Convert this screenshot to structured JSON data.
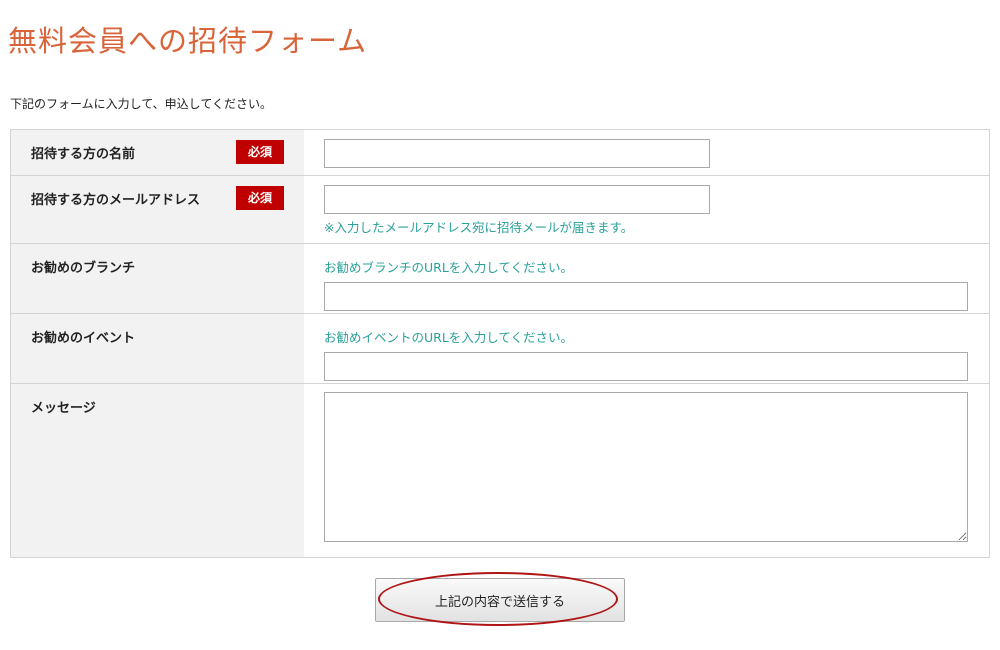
{
  "page": {
    "title": "無料会員への招待フォーム",
    "intro": "下記のフォームに入力して、申込してください。"
  },
  "form": {
    "required_badge": "必須",
    "fields": [
      {
        "label": "招待する方の名前",
        "required": true
      },
      {
        "label": "招待する方のメールアドレス",
        "required": true,
        "hint": "※入力したメールアドレス宛に招待メールが届きます。"
      },
      {
        "label": "お勧めのブランチ",
        "required": false,
        "hint": "お勧めブランチのURLを入力してください。"
      },
      {
        "label": "お勧めのイベント",
        "required": false,
        "hint": "お勧めイベントのURLを入力してください。"
      },
      {
        "label": "メッセージ",
        "required": false
      }
    ],
    "submit_label": "上記の内容で送信する"
  },
  "colors": {
    "title": "#d9643a",
    "required_badge": "#c00000",
    "hint": "#2aa198",
    "highlight": "#b01515"
  }
}
